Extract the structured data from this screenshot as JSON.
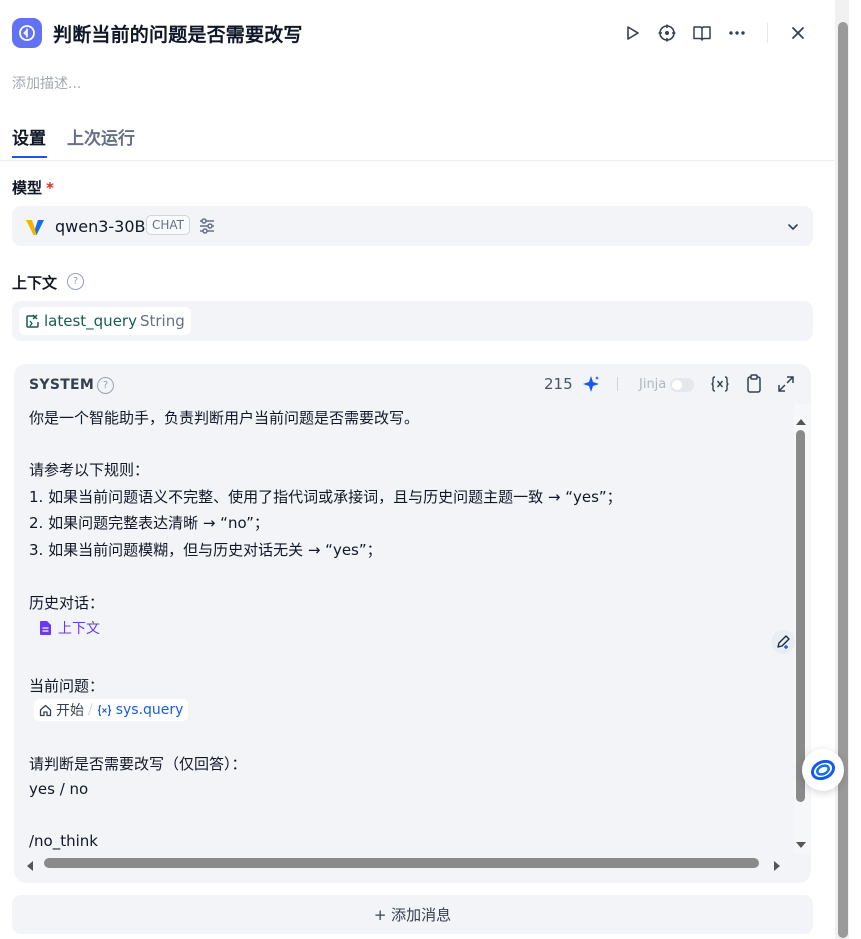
{
  "header": {
    "title": "判断当前的问题是否需要改写",
    "icon": "question-classifier-icon",
    "actions": [
      "run-icon",
      "locate-icon",
      "book-icon",
      "more-icon",
      "close-icon"
    ]
  },
  "description_placeholder": "添加描述...",
  "tabs": [
    {
      "label": "设置",
      "active": true
    },
    {
      "label": "上次运行",
      "active": false
    }
  ],
  "model": {
    "label": "模型",
    "required_mark": "*",
    "name": "qwen3-30B",
    "badge": "CHAT"
  },
  "context": {
    "label": "上下文",
    "help": "?",
    "variable": {
      "name": "latest_query",
      "type": "String"
    }
  },
  "system": {
    "title": "SYSTEM",
    "help": "?",
    "count": "215",
    "jinja_label": "Jinja",
    "jinja_enabled": false,
    "lines": [
      "你是一个智能助手，负责判断用户当前问题是否需要改写。",
      "请参考以下规则：",
      "1. 如果当前问题语义不完整、使用了指代词或承接词，且与历史问题主题一致 → “yes”；",
      "2. 如果问题完整表达清晰 → “no”；",
      "3. 如果当前问题模糊，但与历史对话无关 → “yes”；",
      "历史对话：",
      "当前问题：",
      "请判断是否需要改写（仅回答）：",
      "yes / no",
      "/no_think"
    ],
    "context_chip": "上下文",
    "query_chip": {
      "node": "开始",
      "separator": "/",
      "var": "sys.query"
    }
  },
  "add_message_label": "+ 添加消息",
  "colors": {
    "accent": "#155aef",
    "node_icon": "#6172f3",
    "panel_bg": "#f2f4f7",
    "required": "#d92d20",
    "context_var": "#155d4f",
    "context_chip": "#6938ef",
    "sys_var": "#155aef"
  }
}
